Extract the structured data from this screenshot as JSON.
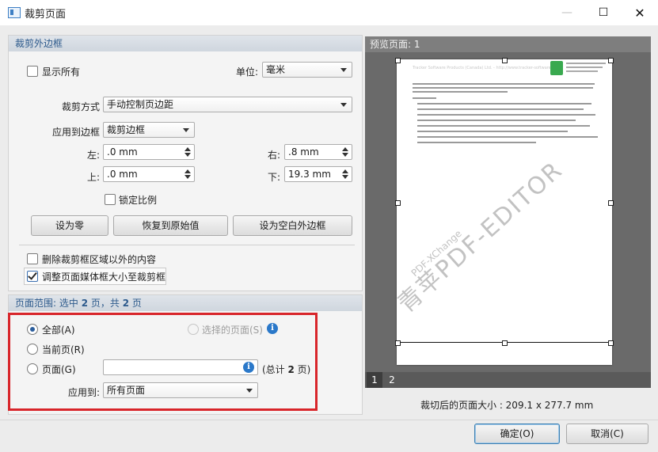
{
  "window": {
    "title": "裁剪页面"
  },
  "margins": {
    "header": "裁剪外边框",
    "show_all_label": "显示所有",
    "unit_label": "单位:",
    "unit_value": "毫米",
    "crop_mode_label": "裁剪方式",
    "crop_mode_value": "手动控制页边距",
    "apply_box_label": "应用到边框",
    "apply_box_value": "裁剪边框",
    "left_label": "左:",
    "left_value": ".0 mm",
    "right_label": "右:",
    "right_value": ".8 mm",
    "top_label": "上:",
    "top_value": ".0 mm",
    "bottom_label": "下:",
    "bottom_value": "19.3 mm",
    "lock_ratio_label": "锁定比例",
    "set_zero_button": "设为零",
    "restore_button": "恢复到原始值",
    "set_blank_button": "设为空白外边框",
    "remove_outside_label": "删除裁剪框区域以外的内容",
    "adjust_media_label": "调整页面媒体框大小至裁剪框"
  },
  "page_range": {
    "header_prefix": "页面范围: 选中 ",
    "selected_count": "2",
    "header_mid": " 页，共 ",
    "total_count": "2",
    "header_suffix": " 页",
    "all_label": "全部(A)",
    "selected_pages_label": "选择的页面(S)",
    "current_label": "当前页(R)",
    "pages_label": "页面(G)",
    "pages_value": "",
    "total_prefix": "(总计 ",
    "total_value": "2",
    "total_suffix": " 页)",
    "apply_to_label": "应用到:",
    "apply_to_value": "所有页面"
  },
  "preview": {
    "header": "预览页面: 1",
    "page_tabs": [
      "1",
      "2"
    ],
    "size_label": "裁切后的页面大小 : 209.1 x 277.7 mm",
    "page_heading": "Tracker Software Products (Canada) Ltd. - http://www.tracker-software.com",
    "watermark_main": "青苹PDF-EDITOR",
    "watermark_sub": "PDF-XChange"
  },
  "footer": {
    "ok_button": "确定(O)",
    "cancel_button": "取消(C)"
  },
  "colors": {
    "accent": "#2d5a8c",
    "highlight_box": "#d8252a",
    "info": "#2a78c9"
  },
  "icons": {
    "app": "app-window-icon",
    "minimize": "minimize-icon",
    "maximize": "maximize-icon",
    "close": "close-icon",
    "info": "info-icon"
  }
}
